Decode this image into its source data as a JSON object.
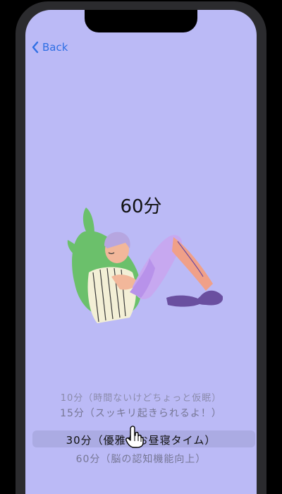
{
  "nav": {
    "back_label": "Back"
  },
  "selected_duration": "60分",
  "picker": {
    "options": [
      "10分（時間ないけどちょっと仮眠）",
      "15分（スッキリ起きられるよ！）",
      "30分（優雅なお昼寝タイム）",
      "60分（脳の認知機能向上）"
    ],
    "highlighted_index": 2
  },
  "colors": {
    "screen_background": "#bbbaf6",
    "accent": "#2f6fe4",
    "picker_highlight": "#ababe3"
  },
  "icons": {
    "back": "chevron-left-icon",
    "cursor": "hand-pointer-icon"
  }
}
